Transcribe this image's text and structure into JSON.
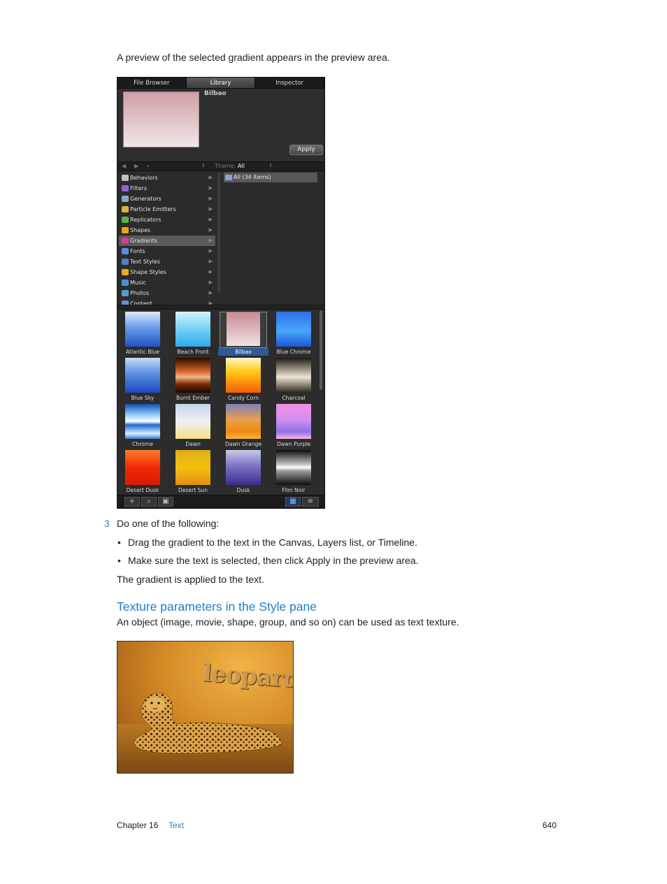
{
  "intro_text": "A preview of the selected gradient appears in the preview area.",
  "library": {
    "tabs": [
      "File Browser",
      "Library",
      "Inspector"
    ],
    "active_tab": "Library",
    "preview_name": "Bilbao",
    "apply_label": "Apply",
    "nav_path": "-",
    "theme_label": "Theme:",
    "theme_value": "All",
    "categories": [
      {
        "label": "Behaviors",
        "color": "#c0c0c0"
      },
      {
        "label": "Filters",
        "color": "#9b5fd1"
      },
      {
        "label": "Generators",
        "color": "#8aa7c7"
      },
      {
        "label": "Particle Emitters",
        "color": "#e0b040"
      },
      {
        "label": "Replicators",
        "color": "#59b04a"
      },
      {
        "label": "Shapes",
        "color": "#f0a020"
      },
      {
        "label": "Gradients",
        "color": "#d04090"
      },
      {
        "label": "Fonts",
        "color": "#5a8fd8"
      },
      {
        "label": "Text Styles",
        "color": "#4f7fc8"
      },
      {
        "label": "Shape Styles",
        "color": "#e0b020"
      },
      {
        "label": "Music",
        "color": "#4a8fd8"
      },
      {
        "label": "Photos",
        "color": "#5a9ac8"
      },
      {
        "label": "Content",
        "color": "#6a8fc8"
      }
    ],
    "selected_category": "Gradients",
    "items_label": "All (34 items)",
    "gradients": [
      {
        "name": "Atlantic Blue",
        "css": "linear-gradient(#dfe9f7, #6a9ce8 45%, #1f54c8)"
      },
      {
        "name": "Beach Front",
        "css": "linear-gradient(#d7f3fb, #7cd4f4 45%, #2fa9ec)"
      },
      {
        "name": "Bilbao",
        "css": "linear-gradient(#c98c95, #f0e2e4)"
      },
      {
        "name": "Blue Chrome",
        "css": "linear-gradient(#2e6fe8, #49a7fb 55%, #1b58d8)"
      },
      {
        "name": "Blue Sky",
        "css": "linear-gradient(#c5dcf5, #5b90e0 45%, #1d48c0)"
      },
      {
        "name": "Burnt Ember",
        "css": "linear-gradient(#2a0b02, #d86a28 40%, #f0b888 55%, #7a2a08 75%, #1a0501)"
      },
      {
        "name": "Candy Corn",
        "css": "linear-gradient(#fff6d0, #ffd021 35%, #ff9a10 65%, #f25d06)"
      },
      {
        "name": "Charcoal",
        "css": "linear-gradient(#1d1a16, #c9c0ad 45%, #ece6d6 55%, #2a251d)"
      },
      {
        "name": "Chrome",
        "css": "linear-gradient(#0e4fb3, #8fc8f5 30%, #ffffff 50%, #1d6ad0 60%, #d8eefc 85%, #3a7ad8)"
      },
      {
        "name": "Dawn",
        "css": "linear-gradient(#c9d3ee, #eef1f0 50%, #f7df86)"
      },
      {
        "name": "Dawn Orange",
        "css": "linear-gradient(#7d80b8, #e8a04c 45%, #f08a10 80%, #f7b440)"
      },
      {
        "name": "Dawn Purple",
        "css": "linear-gradient(#f091e0, #d28ef2 45%, #8f72e6 80%, #f7b7e0)"
      },
      {
        "name": "Desert Dusk",
        "css": "linear-gradient(#ff7c2a, #f22806 50%, #d41d02)"
      },
      {
        "name": "Desert Sun",
        "css": "linear-gradient(#dfae1a, #f2c010 50%, #e29010)"
      },
      {
        "name": "Dusk",
        "css": "linear-gradient(#c6cbe5, #7c73c6 45%, #3a2d8c)"
      },
      {
        "name": "Film Noir",
        "css": "linear-gradient(#0c0c0c, #bdbdbd 40%, #ffffff 50%, #9a9a9a 60%, #0c0c0c)"
      }
    ],
    "selected_gradient": "Bilbao",
    "toolbar": {
      "add": "+",
      "search": "⌕",
      "preview": "▣",
      "grid": "▦",
      "list": "≡"
    }
  },
  "step": {
    "number": "3",
    "text": "Do one of the following:",
    "bullets": [
      "Drag the gradient to the text in the Canvas, Layers list, or Timeline.",
      "Make sure the text is selected, then click Apply in the preview area."
    ],
    "result": "The gradient is applied to the text."
  },
  "section": {
    "heading": "Texture parameters in the Style pane",
    "description": "An object (image, movie, shape, group, and so on) can be used as text texture."
  },
  "photo_text": "leopard",
  "footer": {
    "chapter": "Chapter 16",
    "chapter_link": "Text",
    "page": "640"
  }
}
